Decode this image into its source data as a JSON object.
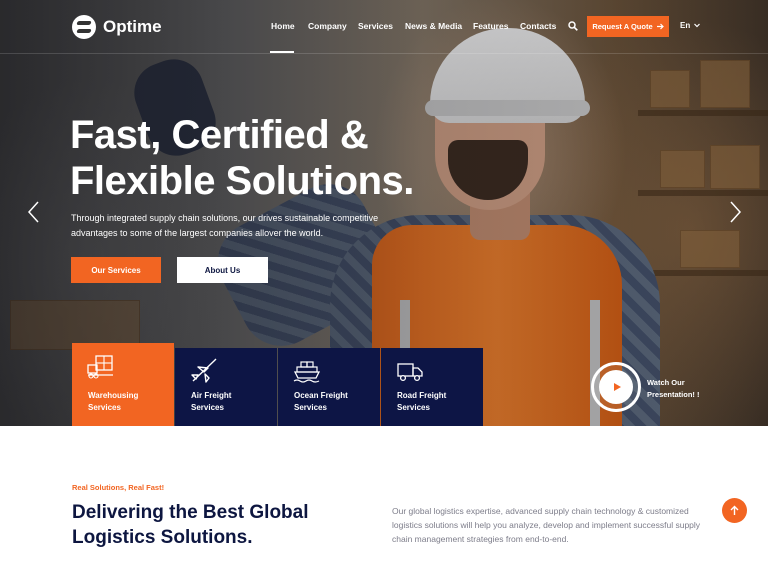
{
  "brand": {
    "name": "Optime",
    "accent": "#f26522",
    "navy": "#0d1545"
  },
  "nav": {
    "items": [
      "Home",
      "Company",
      "Services",
      "News & Media",
      "Features",
      "Contacts"
    ],
    "active": "Home",
    "quote_label": "Request A Quote",
    "language": "En"
  },
  "hero": {
    "title_line1": "Fast, Certified &",
    "title_line2": "Flexible Solutions.",
    "subtitle": "Through integrated supply chain solutions, our drives sustainable competitive advantages to some of the largest companies allover the world.",
    "primary_button": "Our Services",
    "secondary_button": "About Us"
  },
  "services": [
    {
      "label": "Warehousing\nServices",
      "icon": "warehouse-icon",
      "active": true
    },
    {
      "label": "Air Freight\nServices",
      "icon": "airplane-icon",
      "active": false
    },
    {
      "label": "Ocean Freight\nServices",
      "icon": "ship-icon",
      "active": false
    },
    {
      "label": "Road Freight\nServices",
      "icon": "truck-icon",
      "active": false
    }
  ],
  "video": {
    "label_line1": "Watch Our",
    "label_line2": "Presentation! !"
  },
  "about": {
    "eyebrow": "Real Solutions, Real Fast!",
    "title": "Delivering the Best Global Logistics Solutions.",
    "text": "Our global logistics expertise, advanced supply chain technology & customized logistics solutions will help you analyze, develop and implement successful supply chain management strategies from end-to-end."
  }
}
